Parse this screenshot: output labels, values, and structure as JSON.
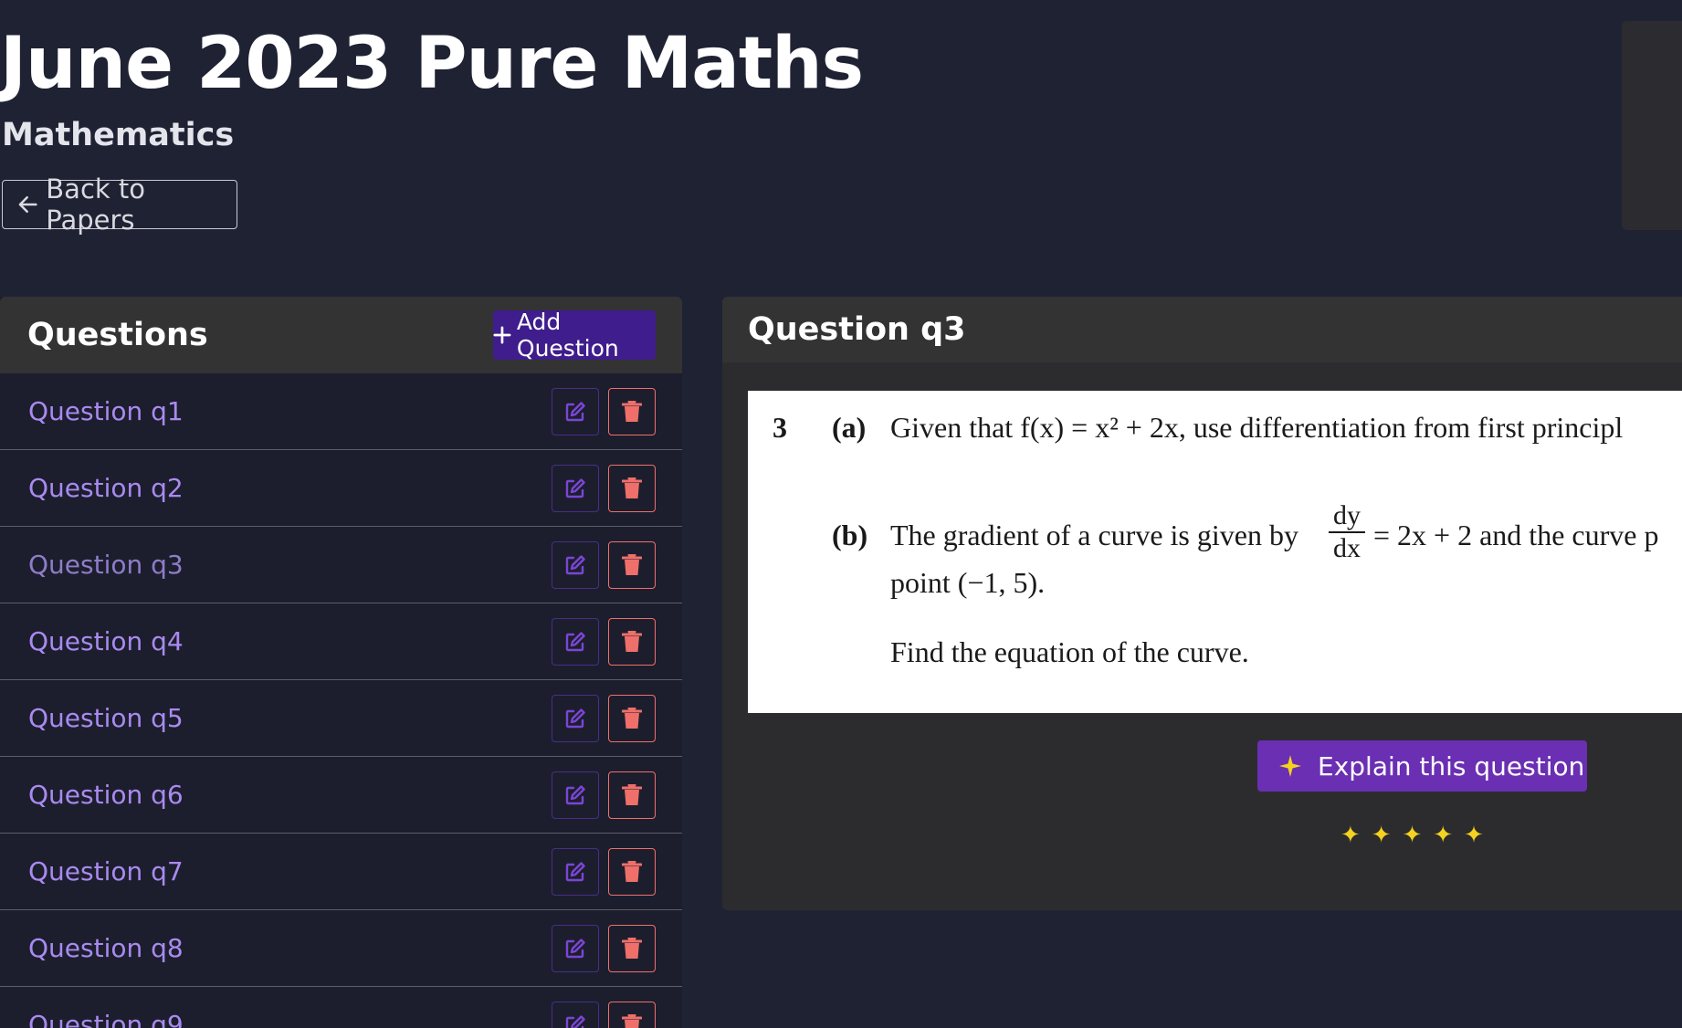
{
  "header": {
    "title": "June 2023 Pure Maths",
    "subject": "Mathematics",
    "back_label": "Back to Papers"
  },
  "questions_panel": {
    "title": "Questions",
    "add_label": "Add Question",
    "items": [
      {
        "label": "Question q1"
      },
      {
        "label": "Question q2"
      },
      {
        "label": "Question q3",
        "active": true
      },
      {
        "label": "Question q4"
      },
      {
        "label": "Question q5"
      },
      {
        "label": "Question q6"
      },
      {
        "label": "Question q7"
      },
      {
        "label": "Question q8"
      },
      {
        "label": "Question q9"
      }
    ]
  },
  "detail": {
    "title": "Question q3",
    "explain_label": "Explain this question",
    "sparkles": "✦✦✦✦✦",
    "question": {
      "number": "3",
      "part_a_label": "(a)",
      "part_a_text": "Given that f(x) = x² + 2x, use differentiation from first principl",
      "part_b_label": "(b)",
      "part_b_text_before": "The gradient of a curve is given by",
      "frac_num": "dy",
      "frac_den": "dx",
      "part_b_text_after": "= 2x + 2  and the curve p",
      "part_b_line2": "point (−1, 5).",
      "part_b_line3": "Find the equation of the curve."
    }
  },
  "colors": {
    "background": "#1f2233",
    "accent": "#3f1d8c",
    "link": "#a98af0",
    "delete": "#ef6f6a",
    "explain": "#6a2fb2"
  },
  "icons": [
    "arrow-left-icon",
    "plus-icon",
    "edit-icon",
    "trash-icon",
    "sparkle-icon"
  ]
}
